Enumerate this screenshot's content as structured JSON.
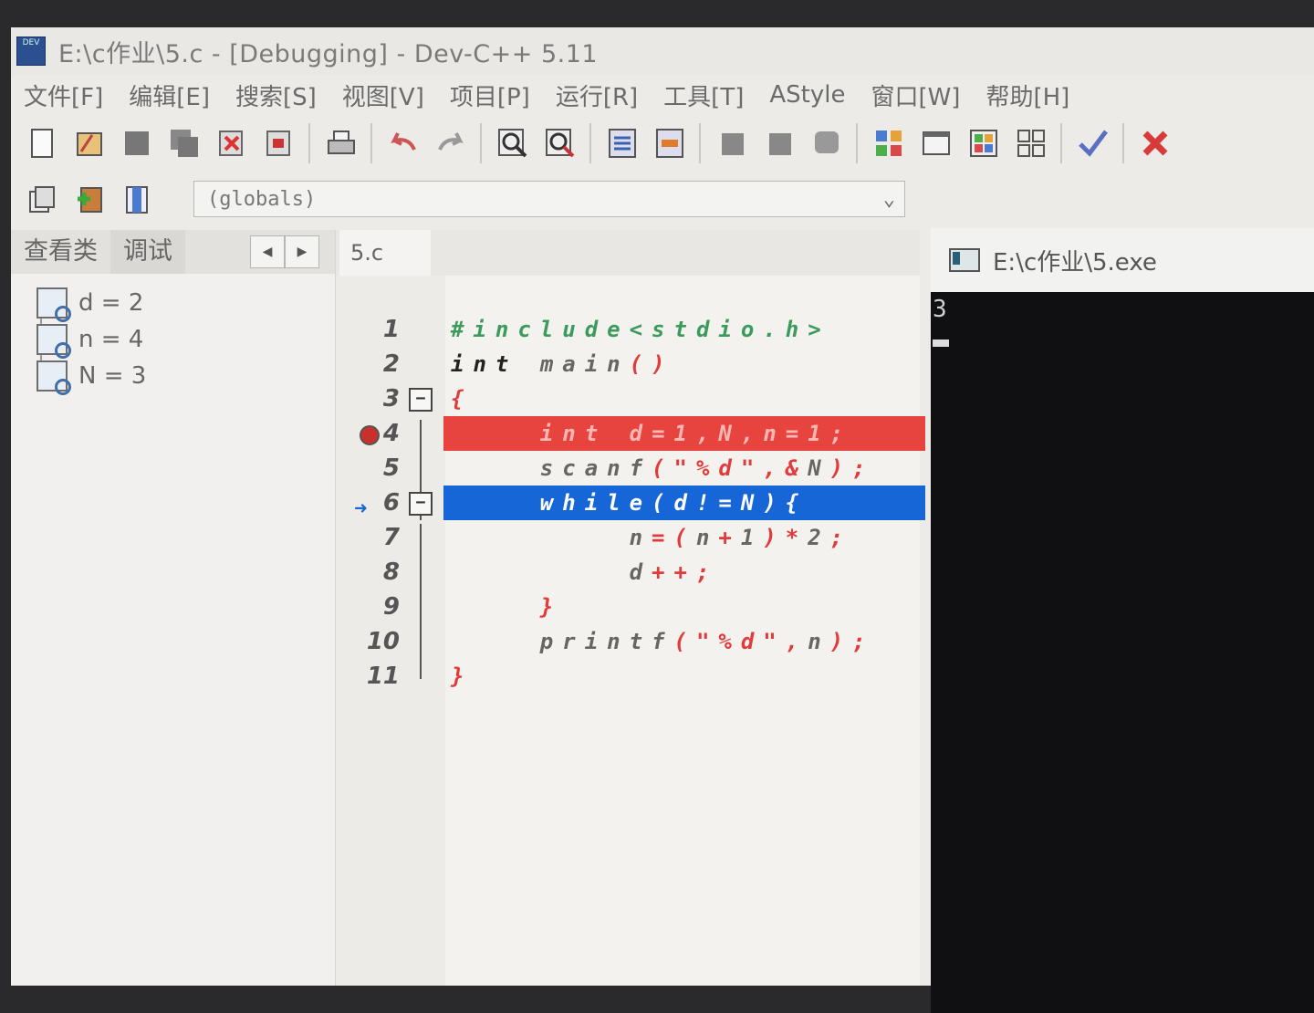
{
  "window": {
    "title": "E:\\c作业\\5.c - [Debugging] - Dev-C++ 5.11",
    "icon_label": "DEV"
  },
  "menu": [
    "文件[F]",
    "编辑[E]",
    "搜索[S]",
    "视图[V]",
    "项目[P]",
    "运行[R]",
    "工具[T]",
    "AStyle",
    "窗口[W]",
    "帮助[H]"
  ],
  "scope_select": {
    "value": "(globals)"
  },
  "left_panel": {
    "tabs": [
      "查看类",
      "调试"
    ],
    "watches": [
      "d = 2",
      "n = 4",
      "N = 3"
    ]
  },
  "editor": {
    "file_tab": "5.c",
    "lines": [
      {
        "num": "1",
        "text": "#include<stdio.h>"
      },
      {
        "num": "2",
        "text": "int main()"
      },
      {
        "num": "3",
        "text": "{"
      },
      {
        "num": "4",
        "text": "    int d=1,N,n=1;"
      },
      {
        "num": "5",
        "text": "    scanf(\"%d\",&N);"
      },
      {
        "num": "6",
        "text": "    while(d!=N){"
      },
      {
        "num": "7",
        "text": "        n=(n+1)*2;"
      },
      {
        "num": "8",
        "text": "        d++;"
      },
      {
        "num": "9",
        "text": "    }"
      },
      {
        "num": "10",
        "text": "    printf(\"%d\",n);"
      },
      {
        "num": "11",
        "text": "}"
      }
    ]
  },
  "console": {
    "title": "E:\\c作业\\5.exe",
    "output": "3"
  },
  "colors": {
    "breakpoint": "#e8443f",
    "current_line": "#1766d8",
    "keyword": "#222222",
    "symbol": "#e23b3b",
    "preprocessor": "#3c9b5c"
  }
}
